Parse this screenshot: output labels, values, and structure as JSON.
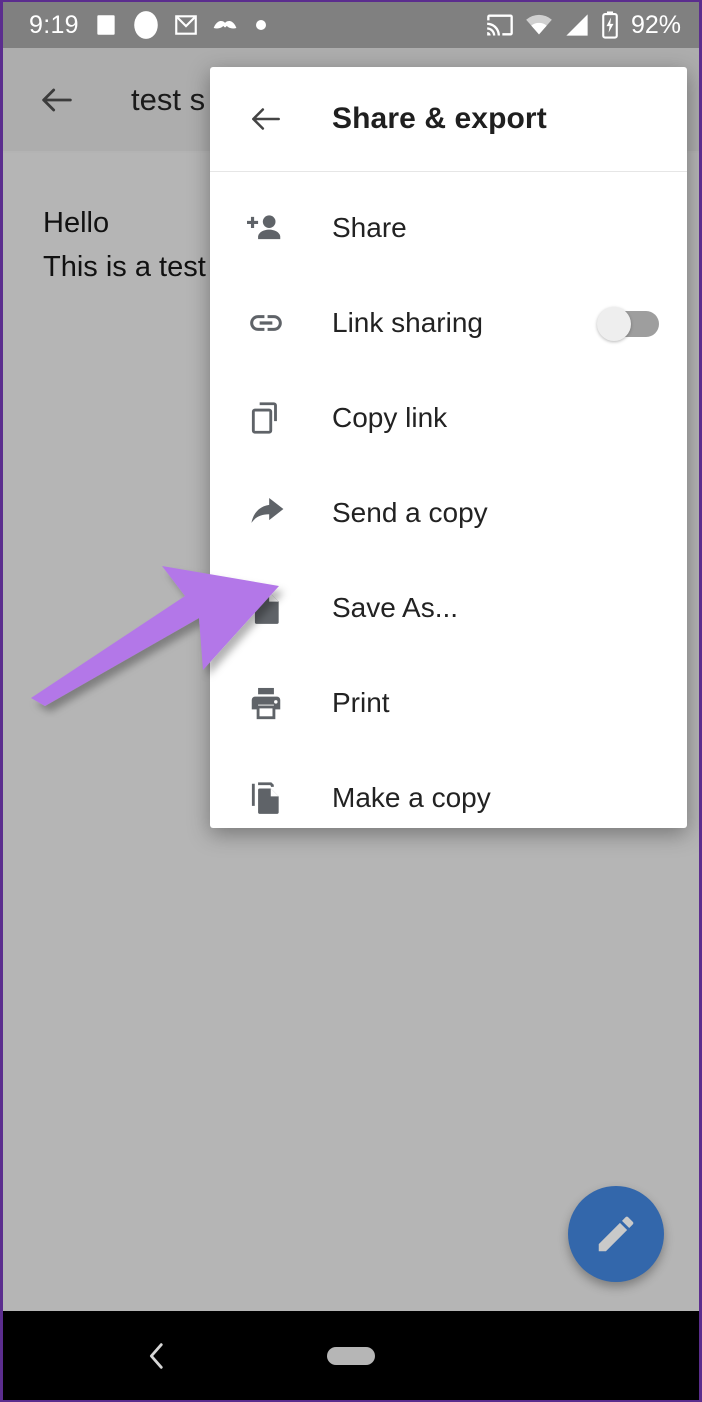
{
  "status_bar": {
    "clock": "9:19",
    "battery_percent": "92%",
    "left_icons": [
      "messages-icon",
      "circle-icon",
      "gmail-icon",
      "moustache-icon",
      "dot-icon"
    ],
    "right_icons": [
      "cast-icon",
      "wifi-icon",
      "cellular-signal-icon",
      "battery-charging-icon"
    ],
    "background": "#808080",
    "foreground": "#ffffff"
  },
  "app_bar": {
    "back_icon": "arrow-back-icon",
    "title": "test s"
  },
  "document": {
    "lines": [
      "Hello",
      "This is a test fi"
    ]
  },
  "fab": {
    "icon": "pencil-edit-icon",
    "color": "#3367ab"
  },
  "nav_bar": {
    "back_icon": "chevron-back-icon",
    "home_pill": "home-pill-handle",
    "background": "#000000"
  },
  "dialog": {
    "back_icon": "arrow-back-icon",
    "title": "Share & export",
    "items": [
      {
        "label": "Share",
        "icon": "person-add-icon",
        "has_toggle": false
      },
      {
        "label": "Link sharing",
        "icon": "link-icon",
        "has_toggle": true,
        "toggle_state": "off"
      },
      {
        "label": "Copy link",
        "icon": "copy-link-icon",
        "has_toggle": false
      },
      {
        "label": "Send a copy",
        "icon": "share-arrow-icon",
        "has_toggle": false
      },
      {
        "label": "Save As...",
        "icon": "file-document-icon",
        "has_toggle": false
      },
      {
        "label": "Print",
        "icon": "printer-icon",
        "has_toggle": false
      },
      {
        "label": "Make a copy",
        "icon": "duplicate-file-icon",
        "has_toggle": false
      }
    ]
  },
  "annotation": {
    "arrow_color": "#b377e8",
    "points_to": "Save As..."
  }
}
